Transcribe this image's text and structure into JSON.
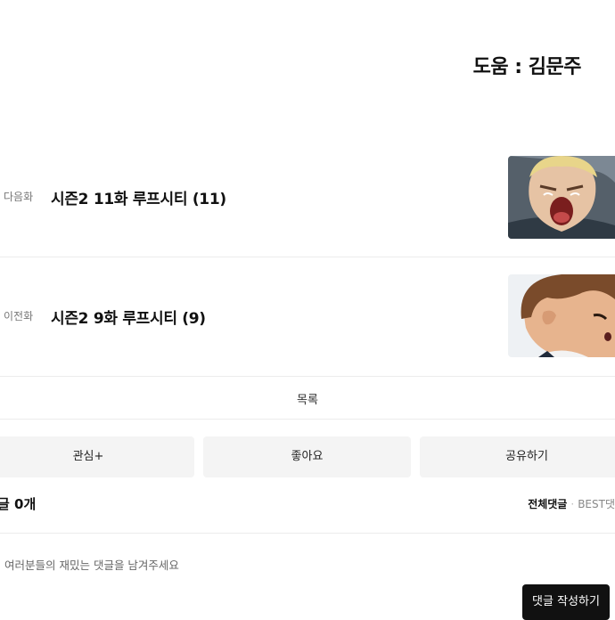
{
  "credit": {
    "text": "도움 : 김문주"
  },
  "episodes": {
    "next": {
      "label": "다음화",
      "title": "시즌2 11화 루프시티 (11)"
    },
    "prev": {
      "label": "이전화",
      "title": "시즌2 9화 루프시티 (9)"
    }
  },
  "list_button": {
    "label": "목록"
  },
  "actions": {
    "interest": "관심+",
    "like": "좋아요",
    "share": "공유하기"
  },
  "comments": {
    "count_label": "글 0개",
    "sort_all": "전체댓글",
    "sort_separator": "·",
    "sort_best": "BEST댓",
    "placeholder": "여러분들의 재밌는 댓글을 남겨주세요",
    "write_button": "댓글 작성하기"
  }
}
